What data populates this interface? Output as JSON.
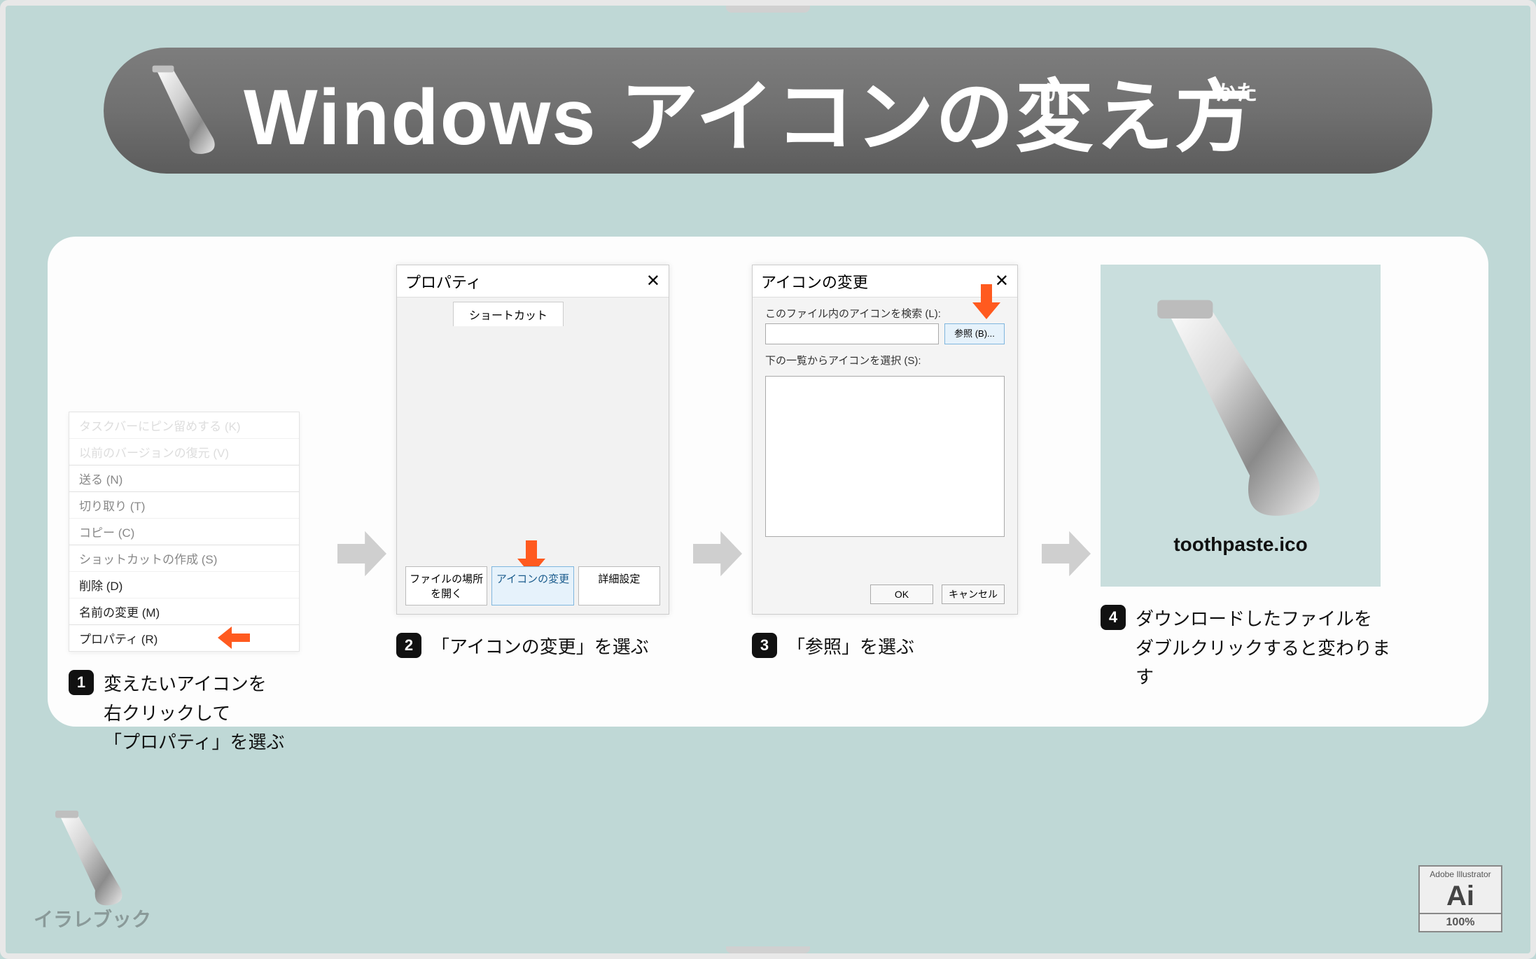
{
  "header": {
    "title": "Windows アイコンの変え方",
    "ruby": [
      "か",
      "かた"
    ]
  },
  "steps": {
    "s1": {
      "ctx_items": [
        "タスクバーにピン留めする (K)",
        "以前のバージョンの復元 (V)",
        "送る (N)",
        "切り取り (T)",
        "コピー (C)",
        "ショットカットの作成 (S)",
        "削除 (D)",
        "名前の変更 (M)",
        "プロパティ (R)"
      ],
      "caption": "変えたいアイコンを\n右クリックして\n「プロパティ」を選ぶ"
    },
    "s2": {
      "dlg_title": "プロパティ",
      "tab": "ショートカット",
      "btn_open": "ファイルの場所を開く",
      "btn_change": "アイコンの変更",
      "btn_adv": "詳細設定",
      "caption": "「アイコンの変更」を選ぶ"
    },
    "s3": {
      "dlg_title": "アイコンの変更",
      "lbl_search": "このファイル内のアイコンを検索 (L):",
      "btn_browse": "参照 (B)...",
      "lbl_select": "下の一覧からアイコンを選択 (S):",
      "btn_ok": "OK",
      "btn_cancel": "キャンセル",
      "caption": "「参照」を選ぶ"
    },
    "s4": {
      "filename": "toothpaste.ico",
      "caption": "ダウンロードしたファイルを\nダブルクリックすると変わります"
    }
  },
  "footer": {
    "brand": "イラレブック",
    "ai_top": "Adobe Illustrator",
    "ai_mid": "Ai",
    "ai_pct": "100%"
  }
}
